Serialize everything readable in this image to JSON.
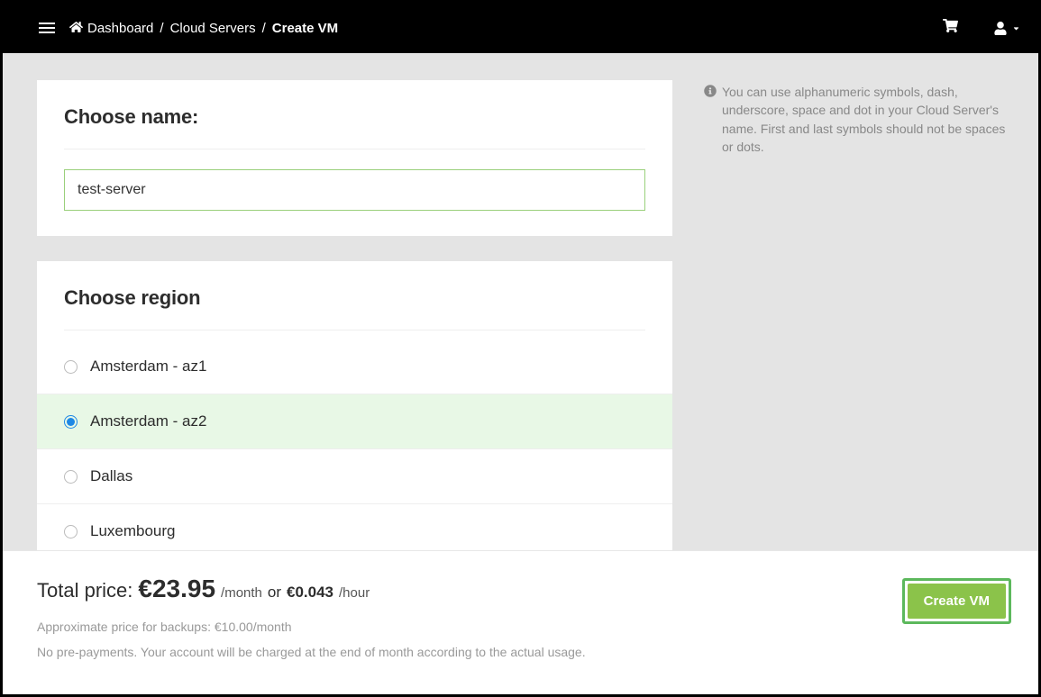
{
  "breadcrumbs": {
    "items": [
      "Dashboard",
      "Cloud Servers"
    ],
    "current": "Create VM"
  },
  "name_section": {
    "title": "Choose name:",
    "value": "test-server"
  },
  "region_section": {
    "title": "Choose region",
    "options": [
      {
        "label": "Amsterdam - az1",
        "selected": false
      },
      {
        "label": "Amsterdam - az2",
        "selected": true
      },
      {
        "label": "Dallas",
        "selected": false
      },
      {
        "label": "Luxembourg",
        "selected": false
      }
    ]
  },
  "info_text": "You can use alphanumeric symbols, dash, underscore, space and dot in your Cloud Server's name. First and last symbols should not be spaces or dots.",
  "footer": {
    "price_label": "Total price:",
    "price_main": "€23.95",
    "price_month_unit": "/month",
    "or": "or",
    "price_hourly": "€0.043",
    "price_hour_unit": "/hour",
    "backup_note": "Approximate price for backups: €10.00/month",
    "payment_note": "No pre-payments. Your account will be charged at the end of month according to the actual usage.",
    "create_label": "Create VM"
  }
}
